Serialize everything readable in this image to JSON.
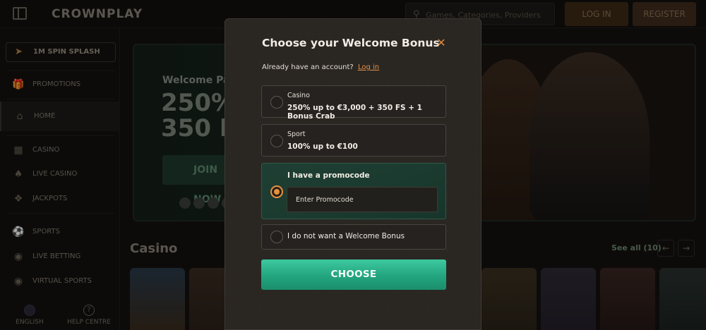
{
  "header": {
    "logo": "CROWNPLAY",
    "search_placeholder": "Games, Categories, Providers",
    "login_label": "LOG IN",
    "register_label": "REGISTER"
  },
  "sidebar": {
    "spin_splash": "1M SPIN SPLASH",
    "items": [
      {
        "label": "PROMOTIONS",
        "icon": "gift-icon"
      },
      {
        "label": "HOME",
        "icon": "home-icon"
      },
      {
        "label": "CASINO",
        "icon": "casino-icon"
      },
      {
        "label": "LIVE CASINO",
        "icon": "spade-icon"
      },
      {
        "label": "JACKPOTS",
        "icon": "jackpot-icon"
      },
      {
        "label": "SPORTS",
        "icon": "ball-icon"
      },
      {
        "label": "LIVE BETTING",
        "icon": "live-betting-icon"
      },
      {
        "label": "VIRTUAL SPORTS",
        "icon": "virtual-sports-icon"
      }
    ],
    "language": "ENGLISH",
    "help": "HELP CENTRE"
  },
  "banner": {
    "welcome_text": "Welcome Pack",
    "line1": "250%",
    "line2": "350 FS",
    "join_label": "JOIN NOW"
  },
  "casino_section": {
    "title": "Casino",
    "see_all": "See all (10)"
  },
  "modal": {
    "title": "Choose your Welcome Bonus",
    "account_text": "Already have an account?",
    "login_link": "Log in",
    "options": [
      {
        "category": "Casino",
        "description": "250% up to €3,000 + 350 FS + 1 Bonus Crab",
        "selected": false
      },
      {
        "category": "Sport",
        "description": "100% up to €100",
        "selected": false
      },
      {
        "category": "",
        "description": "I have a promocode",
        "selected": true
      },
      {
        "category": "",
        "description": "I do not want a Welcome Bonus",
        "selected": false
      }
    ],
    "promocode_placeholder": "Enter Promocode",
    "choose_label": "CHOOSE"
  },
  "colors": {
    "accent_orange": "#e8913d",
    "choose_green": "#2bb38a",
    "modal_bg": "#2a2723"
  }
}
